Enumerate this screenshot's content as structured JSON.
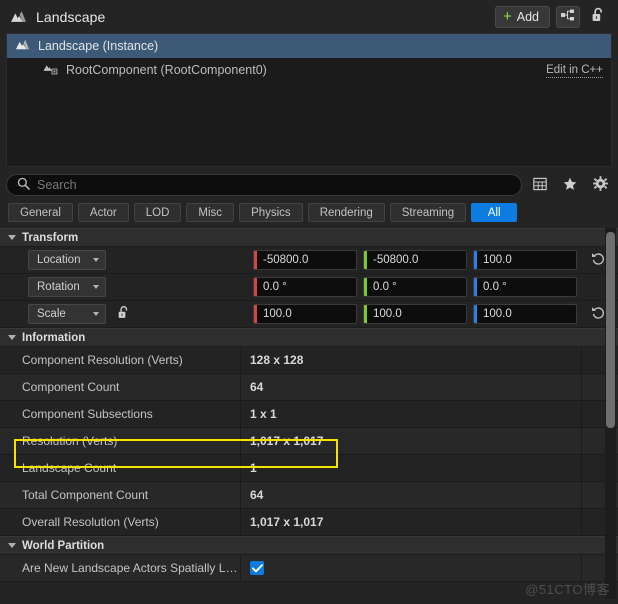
{
  "header": {
    "icon": "landscape-mountain-icon",
    "title": "Landscape",
    "add_label": "Add",
    "add_icon": "plus-icon",
    "hierarchy_icon": "component-graph-icon",
    "lock_icon": "unlocked-padlock-icon"
  },
  "outliner": {
    "rows": [
      {
        "icon": "landscape-mountain-icon",
        "label": "Landscape (Instance)",
        "selected": true,
        "child": false,
        "link": ""
      },
      {
        "icon": "root-component-icon",
        "label": "RootComponent (RootComponent0)",
        "selected": false,
        "child": true,
        "link": "Edit in C++"
      }
    ]
  },
  "search": {
    "icon": "search-icon",
    "value": "",
    "placeholder": "Search",
    "tools": [
      {
        "name": "column-view-icon",
        "glyph": "grid"
      },
      {
        "name": "favorites-star-icon",
        "glyph": "star"
      },
      {
        "name": "settings-gear-icon",
        "glyph": "gear"
      }
    ]
  },
  "filters": {
    "tabs": [
      {
        "label": "General",
        "active": false
      },
      {
        "label": "Actor",
        "active": false
      },
      {
        "label": "LOD",
        "active": false
      },
      {
        "label": "Misc",
        "active": false
      },
      {
        "label": "Physics",
        "active": false
      },
      {
        "label": "Rendering",
        "active": false
      },
      {
        "label": "Streaming",
        "active": false
      },
      {
        "label": "All",
        "active": true
      }
    ]
  },
  "transform": {
    "section_title": "Transform",
    "rows": [
      {
        "label": "Location",
        "has_lock": false,
        "has_reset": true,
        "x": "-50800.0",
        "y": "-50800.0",
        "z": "100.0"
      },
      {
        "label": "Rotation",
        "has_lock": false,
        "has_reset": false,
        "x": "0.0 °",
        "y": "0.0 °",
        "z": "0.0 °"
      },
      {
        "label": "Scale",
        "has_lock": true,
        "has_reset": true,
        "x": "100.0",
        "y": "100.0",
        "z": "100.0"
      }
    ],
    "lock_icon": "unlocked-padlock-icon",
    "reset_icon": "reset-arrow-icon"
  },
  "information": {
    "section_title": "Information",
    "rows": [
      {
        "label": "Component Resolution (Verts)",
        "value": "128 x 128",
        "highlighted": false
      },
      {
        "label": "Component Count",
        "value": "64",
        "highlighted": false
      },
      {
        "label": "Component Subsections",
        "value": "1 x 1",
        "highlighted": false
      },
      {
        "label": "Resolution (Verts)",
        "value": "1,017 x 1,017",
        "highlighted": true
      },
      {
        "label": "Landscape Count",
        "value": "1",
        "highlighted": false
      },
      {
        "label": "Total Component Count",
        "value": "64",
        "highlighted": false
      },
      {
        "label": "Overall Resolution (Verts)",
        "value": "1,017 x 1,017",
        "highlighted": false
      }
    ]
  },
  "world_partition": {
    "section_title": "World Partition",
    "rows": [
      {
        "label": "Are New Landscape Actors Spatially Loa…",
        "checked": true
      }
    ]
  },
  "colors": {
    "accent_blue": "#0c7ce0",
    "highlight_yellow": "#f2e400",
    "axis_x": "#d54545",
    "axis_y": "#79c929",
    "axis_z": "#2b7fe0",
    "plus_green": "#8ee04a",
    "selection_blue": "#3c5a78"
  },
  "watermark": {
    "text": "@51CTO博客"
  }
}
